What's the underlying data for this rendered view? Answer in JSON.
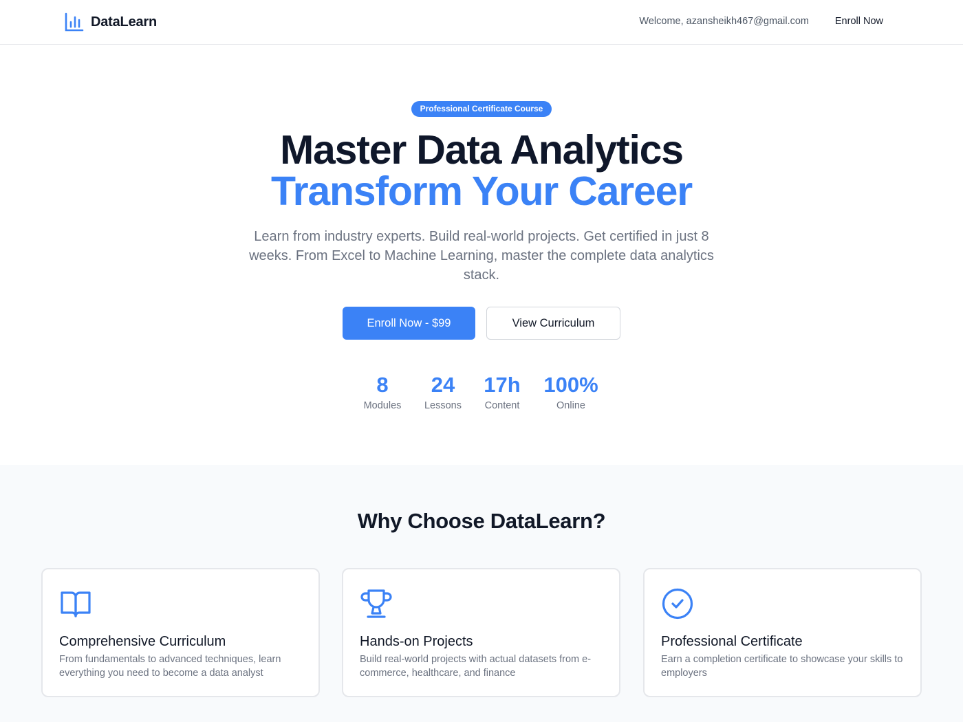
{
  "header": {
    "brand": "DataLearn",
    "welcome": "Welcome, azansheikh467@gmail.com",
    "enroll_link": "Enroll Now"
  },
  "hero": {
    "badge": "Professional Certificate Course",
    "title_line1": "Master Data Analytics",
    "title_line2": "Transform Your Career",
    "lead": "Learn from industry experts. Build real-world projects. Get certified in just 8 weeks. From Excel to Machine Learning, master the complete data analytics stack.",
    "primary_button": "Enroll Now - $99",
    "secondary_button": "View Curriculum",
    "stats": [
      {
        "value": "8",
        "label": "Modules"
      },
      {
        "value": "24",
        "label": "Lessons"
      },
      {
        "value": "17h",
        "label": "Content"
      },
      {
        "value": "100%",
        "label": "Online"
      }
    ]
  },
  "features": {
    "heading": "Why Choose DataLearn?",
    "cards": [
      {
        "icon": "book-icon",
        "title": "Comprehensive Curriculum",
        "desc": "From fundamentals to advanced techniques, learn everything you need to become a data analyst"
      },
      {
        "icon": "trophy-icon",
        "title": "Hands-on Projects",
        "desc": "Build real-world projects with actual datasets from e-commerce, healthcare, and finance"
      },
      {
        "icon": "check-circle-icon",
        "title": "Professional Certificate",
        "desc": "Earn a completion certificate to showcase your skills to employers"
      }
    ]
  },
  "colors": {
    "accent": "#3b82f6",
    "text_dark": "#0f172a",
    "text_muted": "#6b7280",
    "section_bg": "#f8fafc"
  }
}
